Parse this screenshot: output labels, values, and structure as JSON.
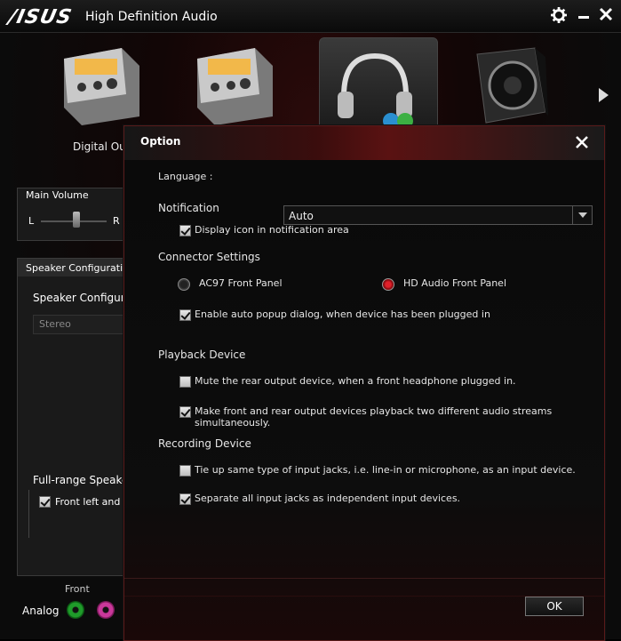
{
  "window": {
    "logo_text": "/ISUS",
    "title": "High Definition Audio",
    "icons": {
      "settings": "gear-icon",
      "minimize": "minimize-icon",
      "close": "close-icon"
    }
  },
  "devices": {
    "items": [
      {
        "name": "digital-output-device-icon",
        "label": "Digital Out"
      },
      {
        "name": "output-device-icon"
      },
      {
        "name": "headphones-device-icon",
        "selected": true
      },
      {
        "name": "speaker-device-icon"
      }
    ],
    "next_icon": "next-arrow-icon"
  },
  "main_volume": {
    "label": "Main Volume",
    "left": "L",
    "right": "R",
    "balance": 0.5
  },
  "speaker_config": {
    "header": "Speaker Configuration",
    "sub_label": "Speaker Configurati",
    "select_value": "Stereo",
    "fullrange_label": "Full-range Speakers",
    "fullrange_checkbox": "Front left and r",
    "fullrange_checked": true
  },
  "jacks": {
    "front_label": "Front",
    "analog_label": "Analog",
    "colors": [
      "#1f9b2a",
      "#c9389a"
    ]
  },
  "dialog": {
    "title": "Option",
    "language_label": "Language :",
    "language_value": "Auto",
    "notification_label": "Notification",
    "display_icon_label": "Display icon in notification area",
    "display_icon_checked": true,
    "connector_label": "Connector Settings",
    "ac97_label": "AC97 Front Panel",
    "hd_audio_label": "HD Audio Front Panel",
    "hd_audio_selected": true,
    "auto_popup_label": "Enable auto popup dialog, when device has been plugged in",
    "auto_popup_checked": true,
    "playback_label": "Playback Device",
    "mute_rear_label": "Mute the rear output device, when a front headphone plugged in.",
    "mute_rear_checked": false,
    "two_streams_label_1": "Make front and rear output devices playback two different audio streams",
    "two_streams_label_2": "simultaneously.",
    "two_streams_checked": true,
    "recording_label": "Recording Device",
    "tie_up_label": "Tie up same type of input jacks, i.e. line-in or microphone, as an input device.",
    "tie_up_checked": false,
    "separate_label": "Separate all input jacks as independent input devices.",
    "separate_checked": true,
    "ok_label": "OK"
  },
  "colors": {
    "accent": "#8b1a1a",
    "radio_selected": "#c0141c",
    "background": "#0d0d0d"
  }
}
